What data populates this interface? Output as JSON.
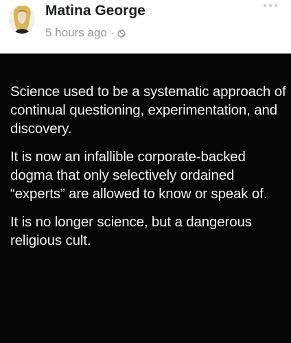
{
  "post": {
    "author": "Matina George",
    "time": "5 hours ago",
    "separator": "·",
    "privacy_icon": "globe-icon",
    "menu_icon": "more-options-icon"
  },
  "content": {
    "paragraphs": [
      "Science used to be a systematic approach of continual questioning, experimentation, and discovery.",
      "It is now an infallible corporate-backed dogma that only selectively ordained “experts” are allowed to know or speak of.",
      "It is no longer science, but a dangerous religious cult."
    ]
  },
  "colors": {
    "background": "#ffffff",
    "image_background": "#050505",
    "text": "#f2f2f2",
    "meta": "#90949c"
  }
}
